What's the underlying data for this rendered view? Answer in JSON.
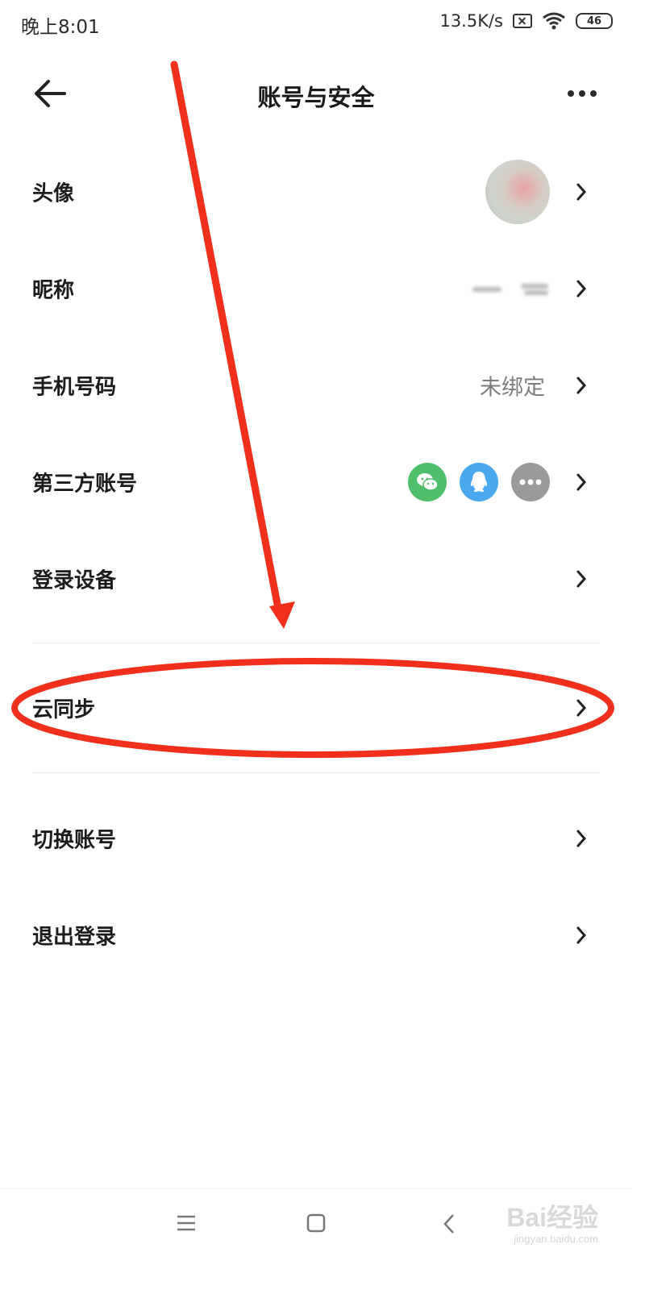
{
  "status_bar": {
    "time": "晚上8:01",
    "net_speed": "13.5K/s",
    "battery": "46"
  },
  "header": {
    "title": "账号与安全"
  },
  "rows": [
    {
      "label": "头像"
    },
    {
      "label": "昵称"
    },
    {
      "label": "手机号码",
      "value": "未绑定"
    },
    {
      "label": "第三方账号"
    },
    {
      "label": "登录设备"
    },
    {
      "label": "云同步"
    },
    {
      "label": "切换账号"
    },
    {
      "label": "退出登录"
    }
  ],
  "third_party_icons": [
    "wechat-icon",
    "qq-icon",
    "more-icon"
  ],
  "colors": {
    "wechat": "#4fbf6b",
    "qq": "#4aa8ef",
    "more": "#9a9a9a",
    "annotation": "#f0301c"
  },
  "watermark": {
    "brand": "Bai",
    "brand2": "经验",
    "url": "jingyan.baidu.com"
  }
}
